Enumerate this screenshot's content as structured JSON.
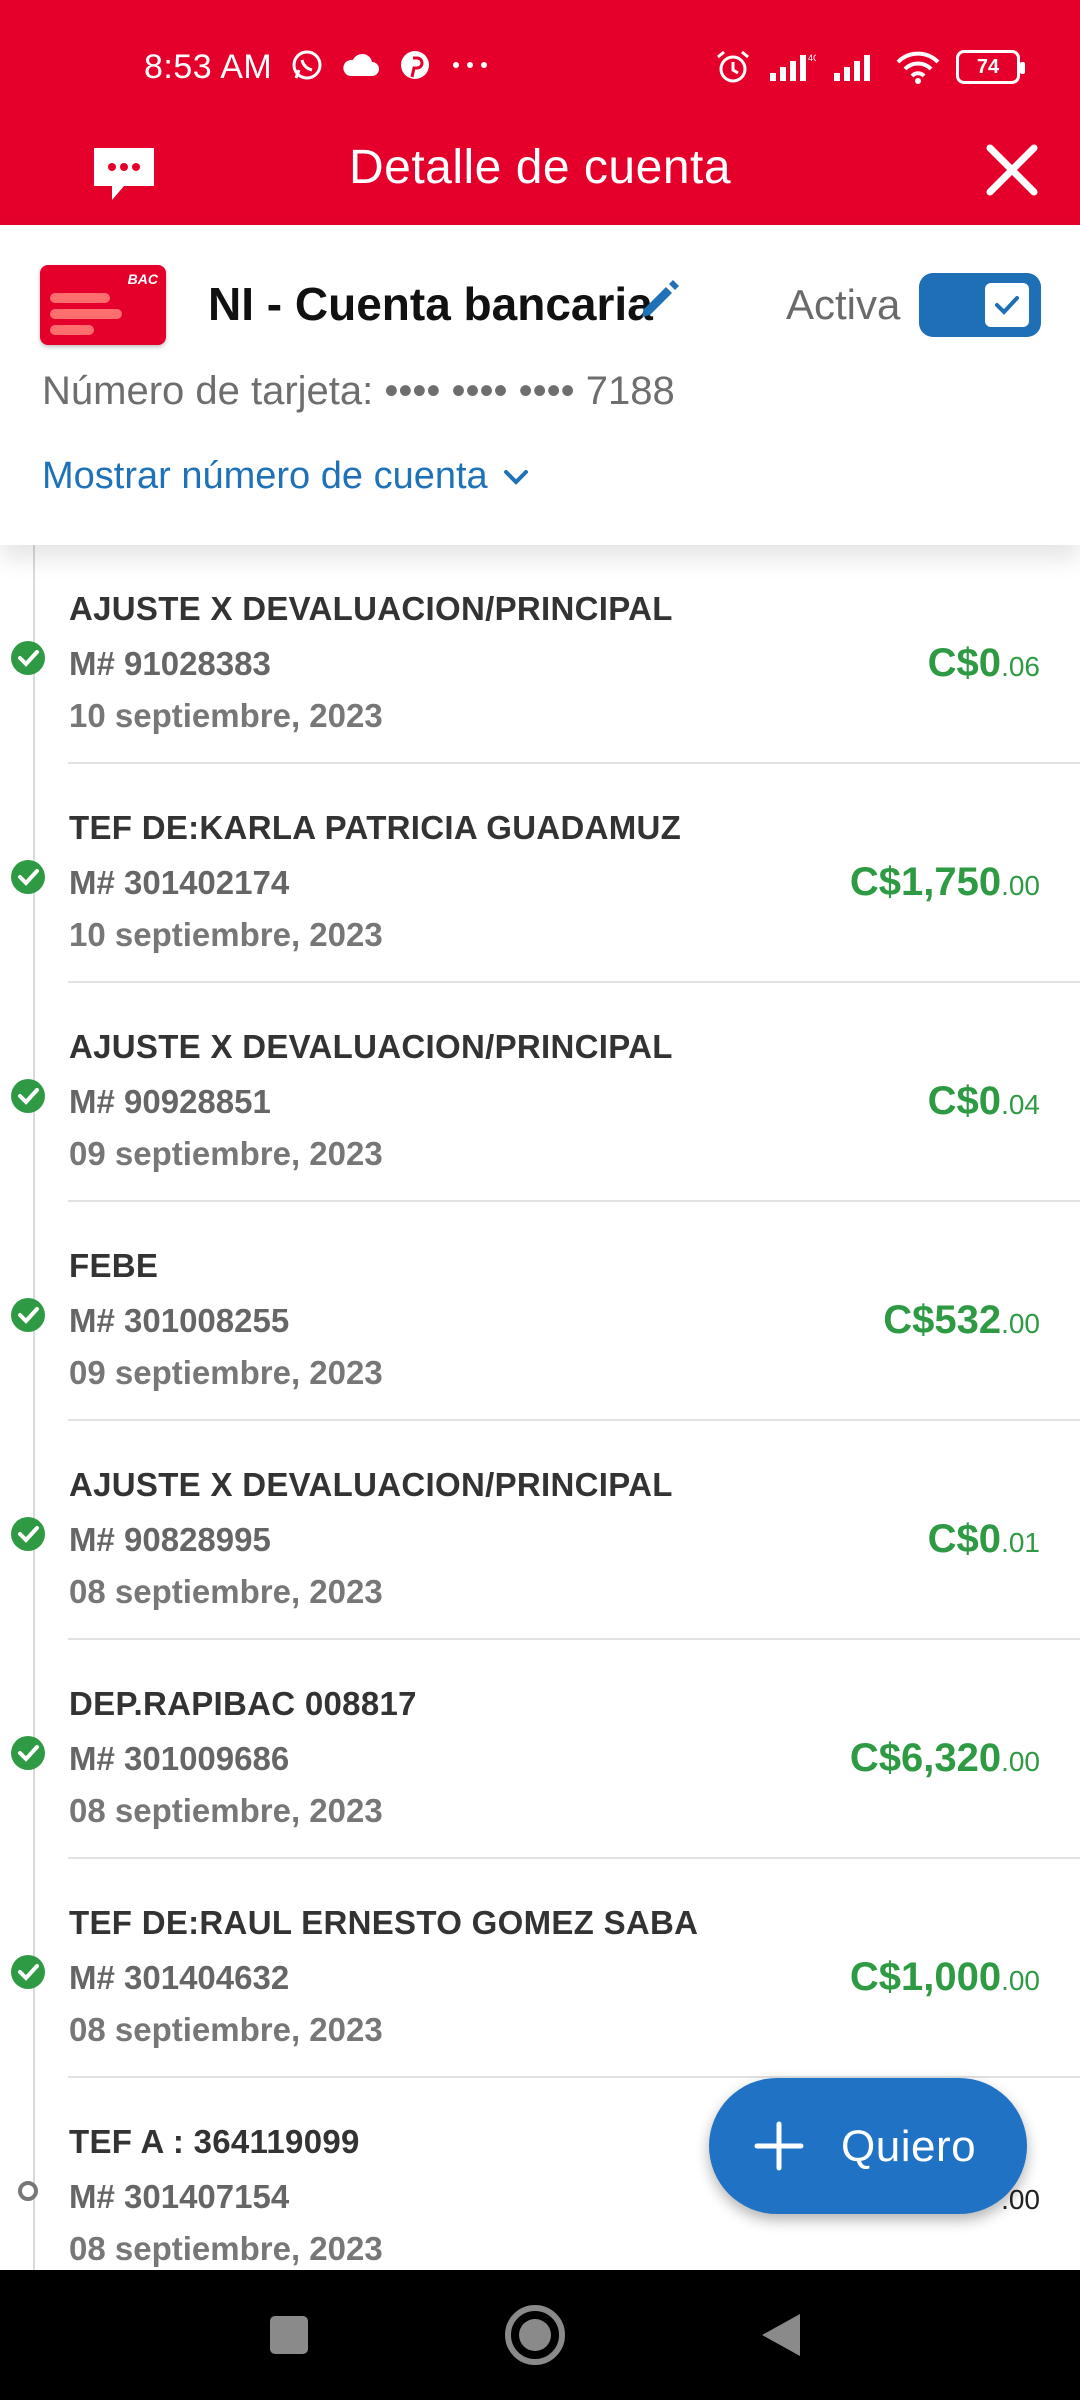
{
  "status_bar": {
    "time": "8:53 AM",
    "battery": "74",
    "icons_left": [
      "whatsapp-icon",
      "cloud-icon",
      "pinterest-icon",
      "more-dots-icon"
    ],
    "icons_right": [
      "alarm-icon",
      "signal-icon",
      "signal-icon",
      "wifi-icon",
      "battery-icon"
    ]
  },
  "app_bar": {
    "title": "Detalle de cuenta",
    "left_icon": "chat-icon",
    "right_icon": "close-icon"
  },
  "account": {
    "bank_logo_text": "BAC",
    "name": "NI - Cuenta bancaria",
    "active_label": "Activa",
    "active": true,
    "card_number": "Número de tarjeta: •••• •••• •••• 7188",
    "show_account_label": "Mostrar número de cuenta"
  },
  "colors": {
    "brand_red": "#e4002b",
    "accent_blue": "#1f72c4",
    "credit_green": "#2e9a44"
  },
  "transactions": [
    {
      "description": "AJUSTE X DEVALUACION/PRINCIPAL",
      "reference": "M# 91028383",
      "date": "10 septiembre, 2023",
      "amount_main": "C$0",
      "amount_cents": ".06",
      "status": "completed"
    },
    {
      "description": "TEF DE:KARLA PATRICIA GUADAMUZ",
      "reference": "M# 301402174",
      "date": "10 septiembre, 2023",
      "amount_main": "C$1,750",
      "amount_cents": ".00",
      "status": "completed"
    },
    {
      "description": "AJUSTE X DEVALUACION/PRINCIPAL",
      "reference": "M# 90928851",
      "date": "09 septiembre, 2023",
      "amount_main": "C$0",
      "amount_cents": ".04",
      "status": "completed"
    },
    {
      "description": "FEBE",
      "reference": "M# 301008255",
      "date": "09 septiembre, 2023",
      "amount_main": "C$532",
      "amount_cents": ".00",
      "status": "completed"
    },
    {
      "description": "AJUSTE X DEVALUACION/PRINCIPAL",
      "reference": "M# 90828995",
      "date": "08 septiembre, 2023",
      "amount_main": "C$0",
      "amount_cents": ".01",
      "status": "completed"
    },
    {
      "description": "DEP.RAPIBAC 008817",
      "reference": "M# 301009686",
      "date": "08 septiembre, 2023",
      "amount_main": "C$6,320",
      "amount_cents": ".00",
      "status": "completed"
    },
    {
      "description": "TEF DE:RAUL ERNESTO GOMEZ SABA",
      "reference": "M# 301404632",
      "date": "08 septiembre, 2023",
      "amount_main": "C$1,000",
      "amount_cents": ".00",
      "status": "completed"
    },
    {
      "description": "TEF A : 364119099",
      "reference": "M# 301407154",
      "date": "08 septiembre, 2023",
      "amount_main": "",
      "amount_cents": ".00",
      "status": "pending"
    }
  ],
  "fab": {
    "label": "Quiero",
    "icon": "plus-icon"
  },
  "nav_bar": {
    "buttons": [
      "recents-button",
      "home-button",
      "back-button"
    ]
  }
}
